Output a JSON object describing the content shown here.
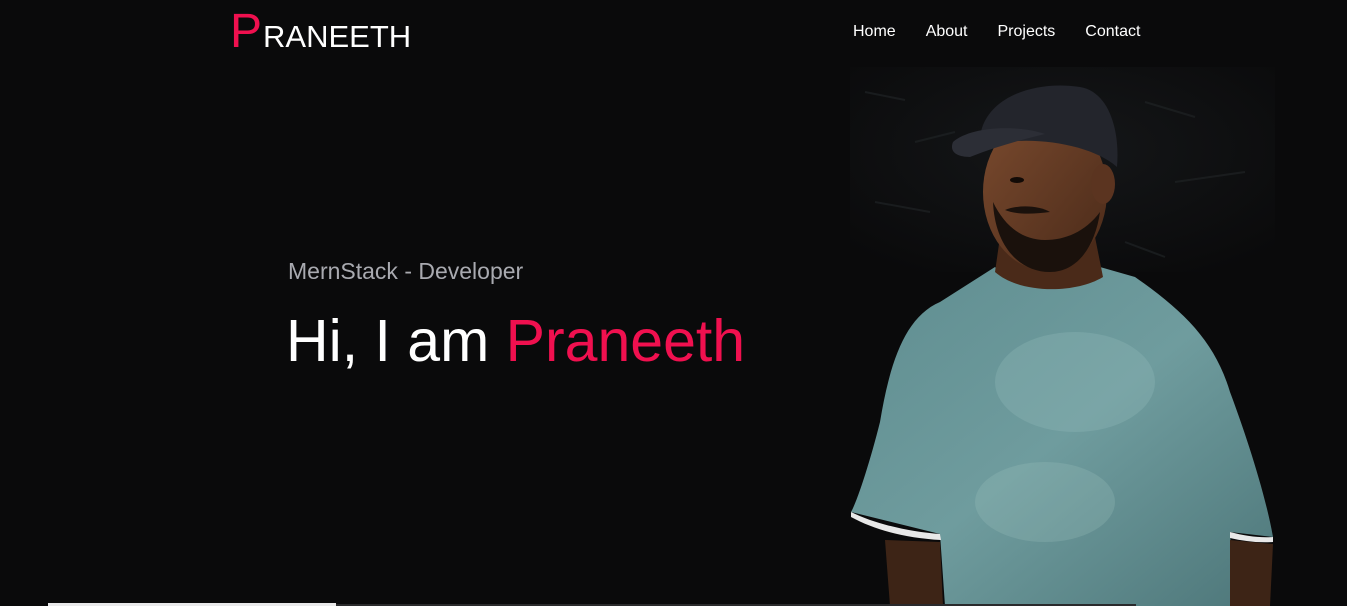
{
  "logo": {
    "first_letter": "P",
    "rest": "RANEETH"
  },
  "nav": {
    "items": [
      {
        "label": "Home"
      },
      {
        "label": "About"
      },
      {
        "label": "Projects"
      },
      {
        "label": "Contact"
      }
    ]
  },
  "hero": {
    "subtitle": "MernStack - Developer",
    "greeting": "Hi, I am ",
    "name": "Praneeth"
  },
  "colors": {
    "accent": "#f0104f",
    "background": "#0a0a0b",
    "subtitle": "#a9aab0",
    "text": "#ffffff"
  }
}
